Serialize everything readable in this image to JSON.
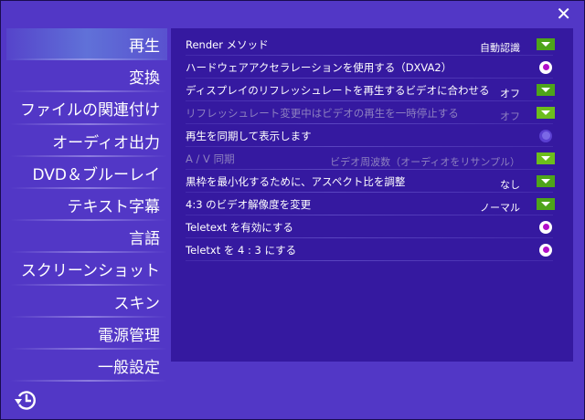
{
  "sidebar": {
    "items": [
      "再生",
      "変換",
      "ファイルの関連付け",
      "オーディオ出力",
      "DVD＆ブルーレイ",
      "テキスト字幕",
      "言語",
      "スクリーンショット",
      "スキン",
      "電源管理",
      "一般設定"
    ]
  },
  "settings": [
    {
      "label": "Render メソッド",
      "value": "自動認識",
      "type": "dropdown",
      "disabled": false
    },
    {
      "label": "ハードウェアアクセラレーションを使用する（DXVA2）",
      "type": "radio",
      "checked": true
    },
    {
      "label": "ディスプレイのリフレッシュレートを再生するビデオに合わせる",
      "value": "オフ",
      "type": "dropdown",
      "disabled": false
    },
    {
      "label": "リフレッシュレート変更中はビデオの再生を一時停止する",
      "value": "オフ",
      "type": "dropdown",
      "disabled": true
    },
    {
      "label": "再生を同期して表示します",
      "type": "radio",
      "checked": false
    },
    {
      "label": "A / V 同期",
      "value": "ビデオ周波数（オーディオをリサンプル）",
      "type": "dropdown",
      "disabled": true
    },
    {
      "label": "黒枠を最小化するために、アスペクト比を調整",
      "value": "なし",
      "type": "dropdown",
      "disabled": false
    },
    {
      "label": "4:3 のビデオ解像度を変更",
      "value": "ノーマル",
      "type": "dropdown",
      "disabled": false
    },
    {
      "label": "Teletext を有効にする",
      "type": "radio",
      "checked": true
    },
    {
      "label": "Teletxt を 4 : 3 にする",
      "type": "radio",
      "checked": true
    }
  ],
  "close_label": "✕"
}
